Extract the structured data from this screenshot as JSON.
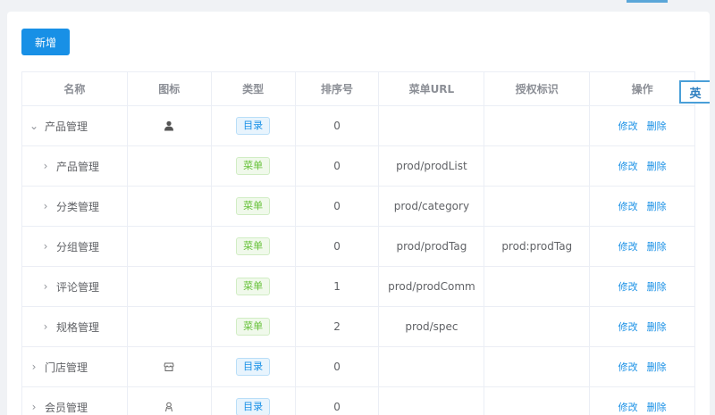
{
  "toolbar": {
    "add_label": "新增"
  },
  "lang_badge": "英",
  "table": {
    "headers": [
      "名称",
      "图标",
      "类型",
      "排序号",
      "菜单URL",
      "授权标识",
      "操作"
    ],
    "actions": {
      "edit": "修改",
      "delete": "删除"
    },
    "rows": [
      {
        "name": "产品管理",
        "level": 0,
        "expand": "⌄",
        "icon": "user-icon",
        "type": "目录",
        "type_kind": "dir",
        "order": "0",
        "url": "",
        "perm": ""
      },
      {
        "name": "产品管理",
        "level": 1,
        "expand": "›",
        "icon": "",
        "type": "菜单",
        "type_kind": "menu",
        "order": "0",
        "url": "prod/prodList",
        "perm": ""
      },
      {
        "name": "分类管理",
        "level": 1,
        "expand": "›",
        "icon": "",
        "type": "菜单",
        "type_kind": "menu",
        "order": "0",
        "url": "prod/category",
        "perm": ""
      },
      {
        "name": "分组管理",
        "level": 1,
        "expand": "›",
        "icon": "",
        "type": "菜单",
        "type_kind": "menu",
        "order": "0",
        "url": "prod/prodTag",
        "perm": "prod:prodTag"
      },
      {
        "name": "评论管理",
        "level": 1,
        "expand": "›",
        "icon": "",
        "type": "菜单",
        "type_kind": "menu",
        "order": "1",
        "url": "prod/prodComm",
        "perm": ""
      },
      {
        "name": "规格管理",
        "level": 1,
        "expand": "›",
        "icon": "",
        "type": "菜单",
        "type_kind": "menu",
        "order": "2",
        "url": "prod/spec",
        "perm": ""
      },
      {
        "name": "门店管理",
        "level": 0,
        "expand": "›",
        "icon": "shop-icon",
        "type": "目录",
        "type_kind": "dir",
        "order": "0",
        "url": "",
        "perm": ""
      },
      {
        "name": "会员管理",
        "level": 0,
        "expand": "›",
        "icon": "member-icon",
        "type": "目录",
        "type_kind": "dir",
        "order": "0",
        "url": "",
        "perm": ""
      }
    ]
  },
  "colors": {
    "primary": "#1890e6",
    "menu_green": "#67c23a"
  }
}
